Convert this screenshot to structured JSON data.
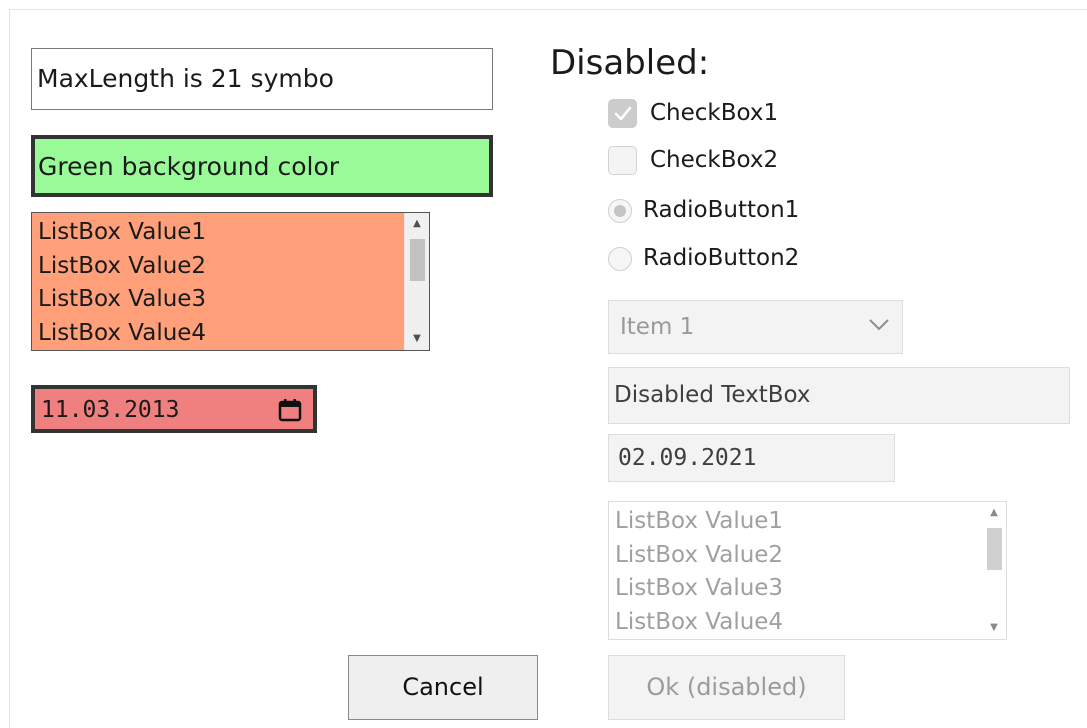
{
  "left": {
    "textbox_value": "MaxLength is 21 symbo",
    "green_textbox_value": "Green background color",
    "listbox_items": [
      "ListBox Value1",
      "ListBox Value2",
      "ListBox Value3",
      "ListBox Value4"
    ],
    "date_value": "11.03.2013",
    "cancel_label": "Cancel"
  },
  "right": {
    "section_title": "Disabled:",
    "checkbox1_label": "CheckBox1",
    "checkbox1_checked": true,
    "checkbox2_label": "CheckBox2",
    "checkbox2_checked": false,
    "radio1_label": "RadioButton1",
    "radio1_selected": true,
    "radio2_label": "RadioButton2",
    "radio2_selected": false,
    "select_value": "Item 1",
    "textbox_value": "Disabled TextBox",
    "date_value": "02.09.2021",
    "listbox_items": [
      "ListBox Value1",
      "ListBox Value2",
      "ListBox Value3",
      "ListBox Value4"
    ],
    "ok_label": "Ok (disabled)"
  },
  "icons": {
    "calendar": "calendar-icon",
    "checkmark": "checkmark-icon",
    "chevron": "chevron-down-icon",
    "scroll_up": "scroll-up-arrow-icon",
    "scroll_down": "scroll-down-arrow-icon"
  },
  "colors": {
    "green_background": "#98fb98",
    "listbox_background": "#ffa07a",
    "date_background": "#f08080",
    "disabled_background": "#f3f3f3"
  }
}
